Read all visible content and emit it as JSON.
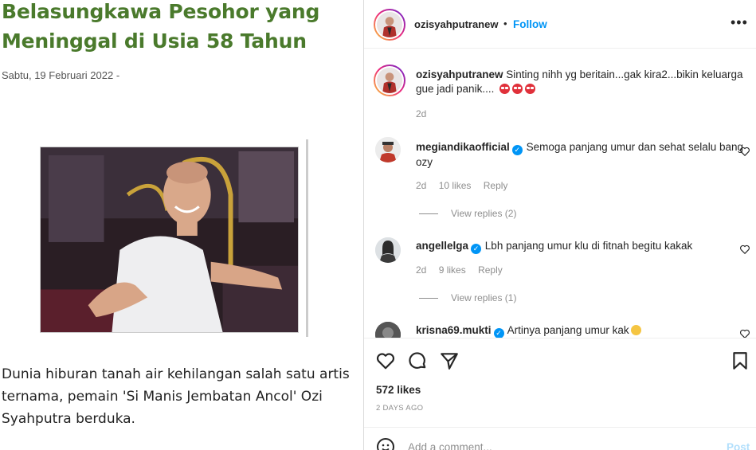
{
  "article": {
    "title": "Belasungkawa Pesohor yang Meninggal di Usia 58 Tahun",
    "date": "Sabtu, 19 Februari 2022  -",
    "body": "Dunia hiburan tanah air kehilangan salah satu artis ternama, pemain 'Si Manis Jembatan Ancol' Ozi Syahputra berduka."
  },
  "post": {
    "username": "ozisyahputranew",
    "dot": "•",
    "follow_label": "Follow",
    "more_icon": "more-horizontal-icon",
    "more_glyph": "•••",
    "caption": {
      "username": "ozisyahputranew",
      "text": "Sinting nihh yg beritain...gak kira2...bikin keluarga gue jadi panik....",
      "time": "2d"
    },
    "comments": [
      {
        "username": "megiandikaofficial",
        "verified": true,
        "text": "Semoga panjang umur dan sehat selalu bang ozy",
        "time": "2d",
        "likes": "10 likes",
        "reply": "Reply",
        "view_replies": "View replies (2)"
      },
      {
        "username": "angellelga",
        "verified": true,
        "text": "Lbh panjang umur klu di fitnah begitu kakak",
        "time": "2d",
        "likes": "9 likes",
        "reply": "Reply",
        "view_replies": "View replies (1)"
      },
      {
        "username": "krisna69.mukti",
        "verified": true,
        "text": "Artinya panjang umur kak"
      }
    ],
    "likes": "572 likes",
    "date": "2 DAYS AGO",
    "add_comment_placeholder": "Add a comment...",
    "post_label": "Post",
    "verified_glyph": "✓"
  },
  "colors": {
    "title_green": "#4a7a2c",
    "link_blue": "#0095f6",
    "muted": "#8e8e8e"
  }
}
